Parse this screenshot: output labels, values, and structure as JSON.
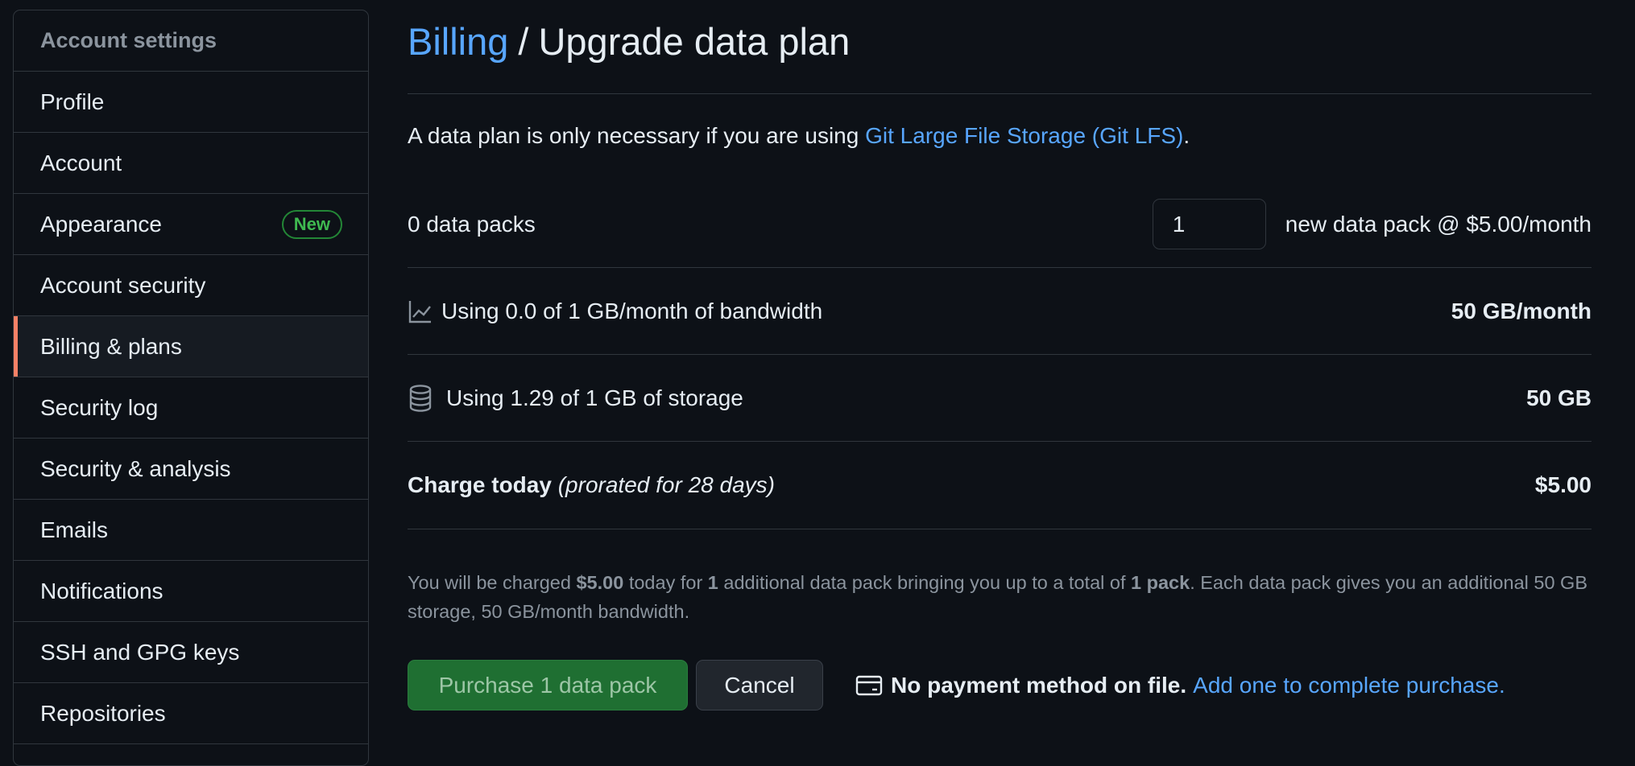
{
  "sidebar": {
    "header": "Account settings",
    "items": [
      {
        "label": "Profile"
      },
      {
        "label": "Account"
      },
      {
        "label": "Appearance",
        "badge": "New"
      },
      {
        "label": "Account security"
      },
      {
        "label": "Billing & plans",
        "active": true
      },
      {
        "label": "Security log"
      },
      {
        "label": "Security & analysis"
      },
      {
        "label": "Emails"
      },
      {
        "label": "Notifications"
      },
      {
        "label": "SSH and GPG keys"
      },
      {
        "label": "Repositories"
      }
    ]
  },
  "heading": {
    "breadcrumb_link": "Billing",
    "separator": "/",
    "title": "Upgrade data plan"
  },
  "intro": {
    "text": "A data plan is only necessary if you are using ",
    "link": "Git Large File Storage (Git LFS)",
    "suffix": "."
  },
  "packs": {
    "current": "0 data packs",
    "quantity": "1",
    "price_label": "new data pack @ $5.00/month"
  },
  "bandwidth": {
    "icon": "graph-icon",
    "label": "Using 0.0 of 1 GB/month of bandwidth",
    "value": "50 GB/month"
  },
  "storage": {
    "icon": "database-icon",
    "label": "Using 1.29 of 1 GB of storage",
    "value": "50 GB"
  },
  "charge": {
    "label": "Charge today",
    "detail": "(prorated for 28 days)",
    "value": "$5.00"
  },
  "note": {
    "p1": "You will be charged ",
    "amount": "$5.00",
    "p2": " today for ",
    "count": "1",
    "p3": " additional data pack bringing you up to a total of ",
    "total": "1 pack",
    "p4": ". Each data pack gives you an additional 50 GB storage, 50 GB/month bandwidth."
  },
  "actions": {
    "purchase": "Purchase 1 data pack",
    "cancel": "Cancel",
    "payment_icon": "credit-card-icon",
    "no_payment": "No payment method on file.",
    "add_payment": "Add one to complete purchase."
  },
  "colors": {
    "background": "#0d1117",
    "border": "#30363d",
    "link": "#58a6ff",
    "active_indicator": "#f78166",
    "badge_green": "#3fb950",
    "primary_button": "#1f6f32"
  }
}
